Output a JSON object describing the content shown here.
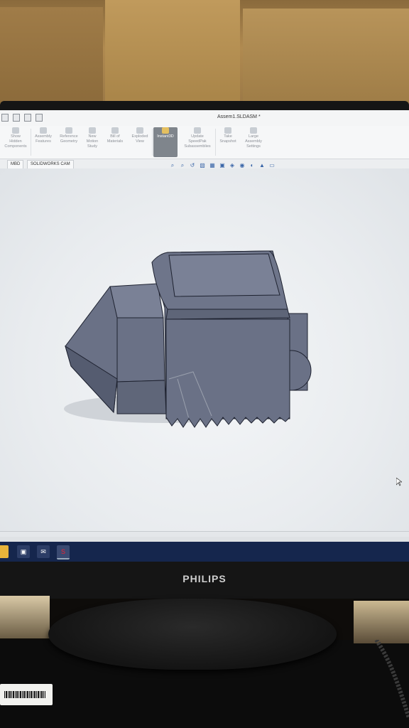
{
  "window": {
    "title": "Assem1.SLDASM *"
  },
  "ribbon": {
    "buttons": [
      {
        "label": "Show Hidden Components",
        "lines": [
          "Show",
          "Hidden",
          "Components"
        ]
      },
      {
        "label": "Assembly Features",
        "lines": [
          "Assembly",
          "Features"
        ]
      },
      {
        "label": "Reference Geometry",
        "lines": [
          "Reference",
          "Geometry"
        ]
      },
      {
        "label": "New Motion Study",
        "lines": [
          "New",
          "Motion",
          "Study"
        ]
      },
      {
        "label": "Bill of Materials",
        "lines": [
          "Bill of",
          "Materials"
        ]
      },
      {
        "label": "Exploded View",
        "lines": [
          "Exploded",
          "View"
        ]
      },
      {
        "label": "Instant3D",
        "lines": [
          "Instant3D"
        ],
        "active": true
      },
      {
        "label": "Update SpeedPak Subassemblies",
        "lines": [
          "Update",
          "SpeedPak",
          "Subassemblies"
        ]
      },
      {
        "label": "Take Snapshot",
        "lines": [
          "Take",
          "Snapshot"
        ]
      },
      {
        "label": "Large Assembly Settings",
        "lines": [
          "Large",
          "Assembly",
          "Settings"
        ]
      }
    ]
  },
  "tabs": [
    {
      "label": "MBD"
    },
    {
      "label": "SOLIDWORKS CAM"
    }
  ],
  "monitor": {
    "brand": "PHILIPS"
  },
  "colors": {
    "model_fill": "#6a7186",
    "model_dark": "#555c70",
    "model_light": "#7e8599",
    "taskbar": "#15264d",
    "viewport": "#eef0f3"
  },
  "icons": {
    "view_toolbar": [
      "zoom-to-fit-icon",
      "zoom-area-icon",
      "previous-view-icon",
      "section-view-icon",
      "dynamic-annotation-icon",
      "view-orientation-icon",
      "display-style-icon",
      "hide-show-icon",
      "edit-appearance-icon",
      "apply-scene-icon",
      "view-settings-icon"
    ],
    "taskbar": [
      "file-explorer-icon",
      "store-icon",
      "mail-icon",
      "solidworks-icon"
    ]
  }
}
